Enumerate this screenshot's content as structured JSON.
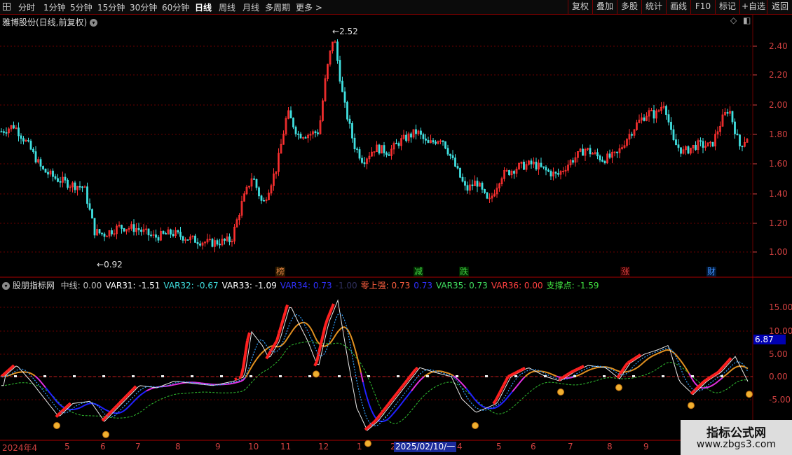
{
  "toolbar": {
    "periods": [
      "分时",
      "1分钟",
      "5分钟",
      "15分钟",
      "30分钟",
      "60分钟",
      "日线",
      "周线",
      "月线",
      "多周期",
      "更多 >"
    ],
    "active_period": "日线",
    "right_buttons": [
      "复权",
      "叠加",
      "多股",
      "统计",
      "画线",
      "F10",
      "标记",
      "+自选",
      "返回"
    ]
  },
  "main_panel": {
    "title": "雅博股份(日线,前复权)",
    "high_label": "2.52",
    "low_label": "0.92",
    "y_ticks": [
      "2.40",
      "2.20",
      "2.00",
      "1.80",
      "1.60",
      "1.40",
      "1.20",
      "1.00"
    ],
    "event_flags": [
      {
        "text": "榜",
        "color": "#e08040"
      },
      {
        "text": "减",
        "color": "#40d040"
      },
      {
        "text": "跌",
        "color": "#40d040"
      },
      {
        "text": "涨",
        "color": "#e04040"
      },
      {
        "text": "财",
        "color": "#4090ff"
      }
    ]
  },
  "indicator_panel": {
    "name": "股朋指标网",
    "values": [
      {
        "text": "中线: 0.00",
        "color": "#c0c0c0"
      },
      {
        "text": "VAR31: -1.51",
        "color": "#ffffff"
      },
      {
        "text": "VAR32: -0.67",
        "color": "#40e0e0"
      },
      {
        "text": "VAR33: -1.09",
        "color": "#ffffff"
      },
      {
        "text": "VAR34: 0.73",
        "color": "#3030ff"
      },
      {
        "text": "-1.00",
        "color": "#303060"
      },
      {
        "text": "零上强: 0.73",
        "color": "#ff6040"
      },
      {
        "text": "0.73",
        "color": "#3030ff"
      },
      {
        "text": "VAR35: 0.73",
        "color": "#40e060"
      },
      {
        "text": "VAR36: 0.00",
        "color": "#ff4040"
      },
      {
        "text": "支撑点: -1.59",
        "color": "#40e040"
      }
    ],
    "y_ticks": [
      "15.00",
      "10.00",
      "5.00",
      "0.00",
      "-5.00"
    ],
    "current_value": "6.87"
  },
  "time_axis": {
    "labels": [
      "2024年4",
      "5",
      "6",
      "7",
      "8",
      "9",
      "10",
      "11",
      "12",
      "1",
      "2",
      "4",
      "5",
      "6",
      "7",
      "8",
      "9"
    ],
    "cursor_date": "2025/02/10/一"
  },
  "watermark": {
    "line1": "指标公式网",
    "line2": "www.zbgs3.com"
  },
  "colors": {
    "up": "#ff3030",
    "down": "#40e0e0",
    "grid": "#6a0000",
    "axis_text": "#d04040"
  }
}
